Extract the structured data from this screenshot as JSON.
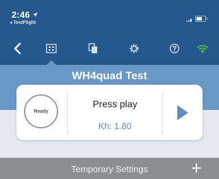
{
  "status_bar": {
    "time": "2:46",
    "back_app": "◂ TestFlight"
  },
  "nav": {
    "items": [
      {
        "icon": "back-chevron-icon"
      },
      {
        "icon": "dashboard-icon",
        "active": true
      },
      {
        "icon": "copy-icon"
      },
      {
        "icon": "gear-icon"
      },
      {
        "icon": "help-icon"
      },
      {
        "icon": "wifi-icon",
        "color": "#56c03a"
      }
    ]
  },
  "header": {
    "title": "WH4quad Test"
  },
  "card": {
    "status": "Ready",
    "heading": "Press play",
    "kh_value": "Kh: 1.80"
  },
  "settings": {
    "title": "Temporary Settings"
  },
  "colors": {
    "topbar": "#24588d",
    "title_band": "#6a98c6",
    "accent": "#5b8fc4",
    "wifi": "#56c03a",
    "settings_bar": "#8b8f93"
  }
}
